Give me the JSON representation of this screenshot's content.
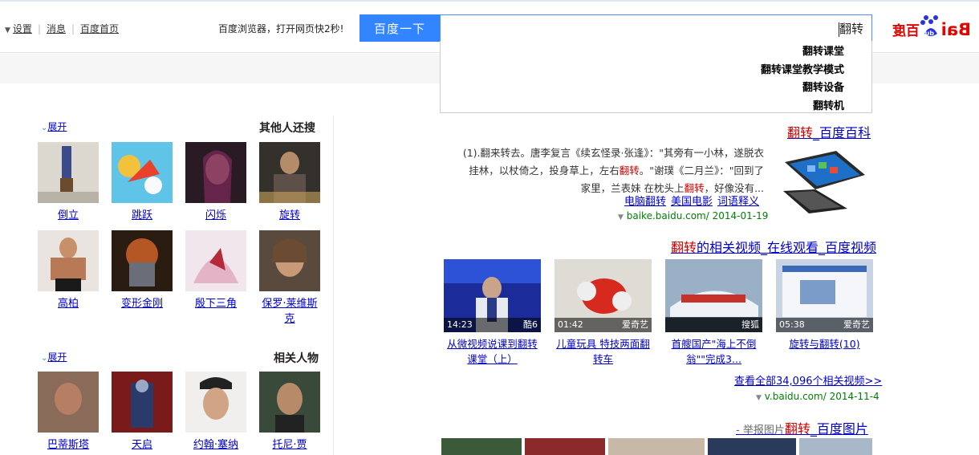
{
  "header": {
    "search_query": "翻转",
    "search_button": "百度一下",
    "browser_promo": "百度浏览器，打开网页快2秒!",
    "links": [
      "百度首页",
      "消息",
      "设置"
    ]
  },
  "suggestions": [
    "翻转课堂",
    "翻转课堂教学模式",
    "翻转设备",
    "翻转机"
  ],
  "sidebar": {
    "others_title": "其他人还搜",
    "expand_label": "展开",
    "others": [
      "倒立",
      "跳跃",
      "闪烁",
      "旋转",
      "高柏",
      "变形金刚",
      "殷下三角",
      "保罗·莱维斯克"
    ],
    "related_title": "相关人物",
    "related": [
      "巴蒂斯塔",
      "天启",
      "约翰·塞纳",
      "托尼·贾"
    ]
  },
  "baike": {
    "title_kw": "翻转",
    "title_rest": "_百度百科",
    "text_1": "(1).翻来转去。唐李复言《续玄怪录·张逢》：\"其旁有一小林，遂脱衣",
    "text_2": "挂林，以杖倚之，投身草上，左右",
    "text_2_kw": "翻转",
    "text_2_end": "。\"谢璞《二月兰》：\"回到了",
    "text_3": "家里，兰表妹 在枕头上",
    "text_3_kw": "翻转",
    "text_3_end": "，好像没有...",
    "links": [
      "词语释义",
      "美国电影",
      "电脑翻转"
    ],
    "url": "baike.baidu.com/ 2014-01-19"
  },
  "video": {
    "title_kw": "翻转",
    "title_rest": "的相关视频_在线观看_百度视频",
    "items": [
      {
        "source": "酷6",
        "duration": "14:23",
        "caption": "从微视频说课到翻转课堂（上）"
      },
      {
        "source": "爱奇艺",
        "duration": "01:42",
        "caption": "儿童玩具 特技两面翻转车"
      },
      {
        "source": "搜狐",
        "duration": "",
        "caption": "首艘国产\"海上不倒翁\"\"完成3..."
      },
      {
        "source": "爱奇艺",
        "duration": "05:38",
        "caption": "旋转与翻转(10)"
      }
    ],
    "more": "查看全部34,096个相关视频>>",
    "url": "v.baidu.com/ 2014-11-4"
  },
  "images": {
    "title_kw": "翻转",
    "title_rest": "_百度图片",
    "suffix": " - 举报图片"
  },
  "colors": {
    "link": "#0000cc",
    "highlight": "#cc0000",
    "button": "#3385ff",
    "url_green": "#008000"
  }
}
